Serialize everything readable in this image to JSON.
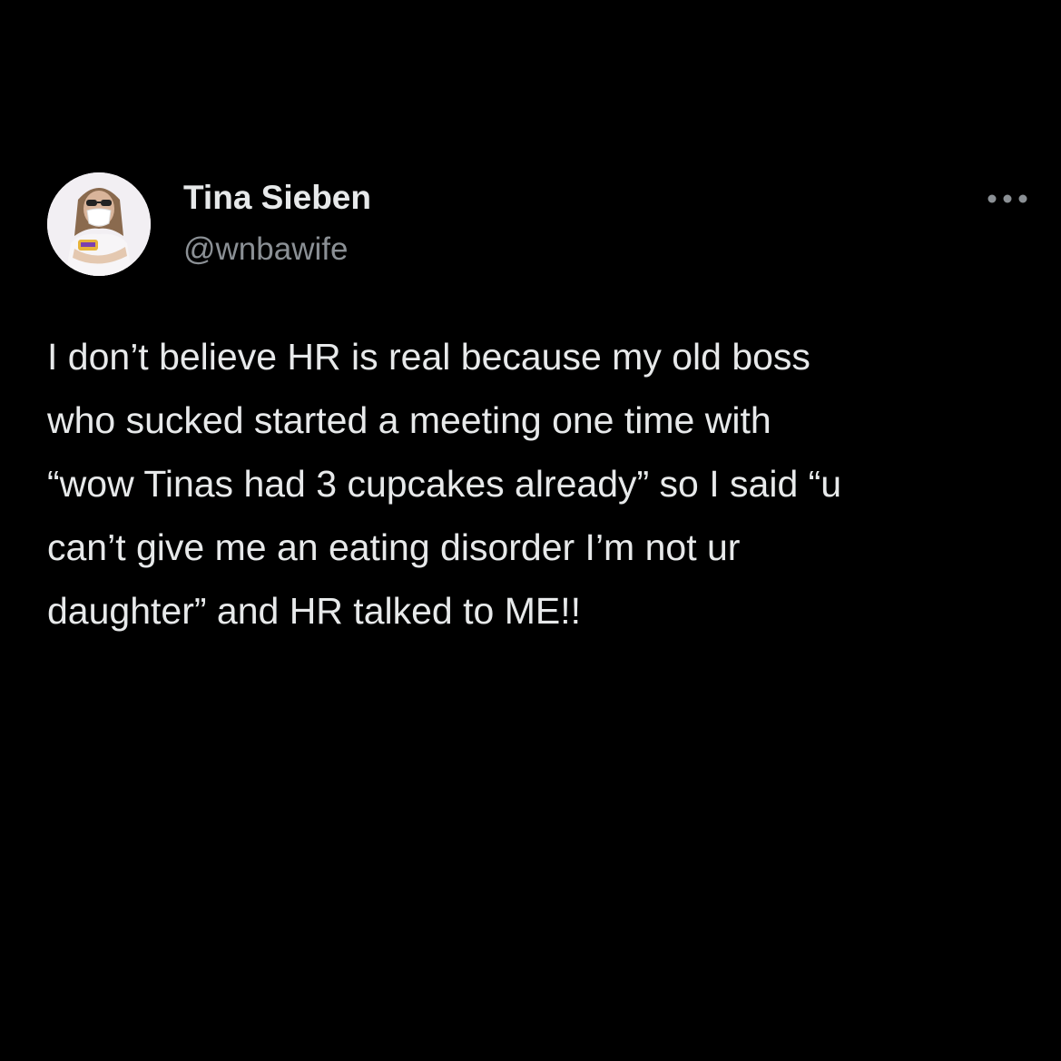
{
  "author": {
    "display_name": "Tina Sieben",
    "handle": "@wnbawife",
    "avatar_icon": "profile-photo"
  },
  "actions": {
    "more_icon": "more-horizontal-icon"
  },
  "tweet": {
    "text": "I don’t believe HR is real because my old boss\nwho sucked started a meeting one time with\n“wow Tinas had 3 cupcakes already” so I said “u\ncan’t give me an eating disorder I’m not ur\ndaughter” and HR talked to ME!!"
  },
  "colors": {
    "background": "#000000",
    "primary_text": "#e7e9ea",
    "secondary_text": "#8b9095"
  }
}
